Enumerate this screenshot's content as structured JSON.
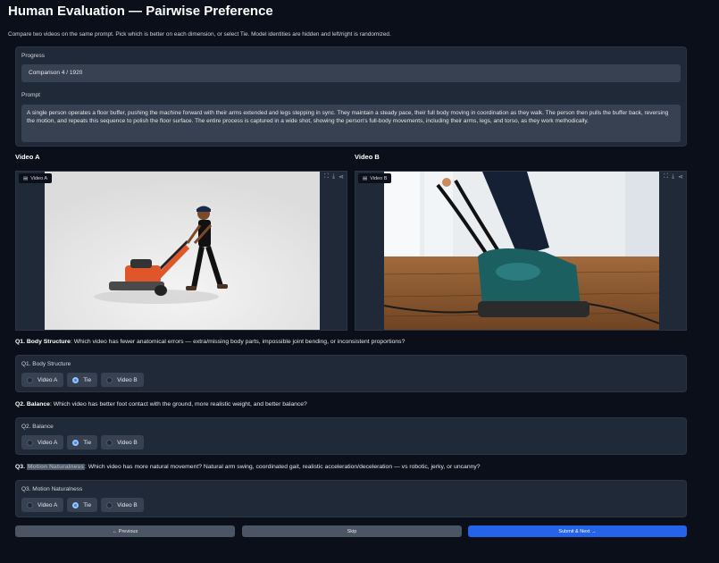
{
  "header": {
    "title": "Human Evaluation — Pairwise Preference",
    "subtitle": "Compare two videos on the same prompt. Pick which is better on each dimension, or select Tie. Model identities are hidden and left/right is randomized."
  },
  "progress": {
    "label": "Progress",
    "value": "Comparison 4 / 1920"
  },
  "prompt": {
    "label": "Prompt",
    "text": "A single person operates a floor buffer, pushing the machine forward with their arms extended and legs stepping in sync. They maintain a steady pace, their full body moving in coordination as they walk. The person then pulls the buffer back, reversing the motion, and repeats this sequence to polish the floor surface. The entire process is captured in a wide shot, showing the person's full-body movements, including their arms, legs, and torso, as they work methodically."
  },
  "videos": {
    "a": {
      "heading": "Video A",
      "tag": "Video A"
    },
    "b": {
      "heading": "Video B",
      "tag": "Video B"
    }
  },
  "questions": [
    {
      "number": "Q1.",
      "name": "Body Structure",
      "text": ": Which video has fewer anatomical errors — extra/missing body parts, impossible joint bending, or inconsistent proportions?",
      "field_label": "Q1. Body Structure",
      "options": [
        "Video A",
        "Tie",
        "Video B"
      ],
      "selected": "Tie"
    },
    {
      "number": "Q2.",
      "name": "Balance",
      "text": ": Which video has better foot contact with the ground, more realistic weight, and better balance?",
      "field_label": "Q2. Balance",
      "options": [
        "Video A",
        "Tie",
        "Video B"
      ],
      "selected": "Tie"
    },
    {
      "number": "Q3.",
      "name": "Motion Naturalness",
      "text": ": Which video has more natural movement? Natural arm swing, coordinated gait, realistic acceleration/deceleration — vs robotic, jerky, or uncanny?",
      "field_label": "Q3. Motion Naturalness",
      "options": [
        "Video A",
        "Tie",
        "Video B"
      ],
      "selected": "Tie"
    }
  ],
  "buttons": {
    "previous": "← Previous",
    "skip": "Skip",
    "submit": "Submit & Next →"
  },
  "colors": {
    "accent": "#2563eb",
    "background": "#0b0f19",
    "panel": "#1f2937"
  }
}
